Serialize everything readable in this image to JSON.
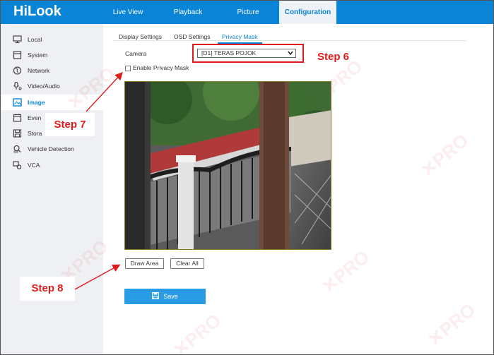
{
  "header": {
    "logo": "HiLook",
    "nav": [
      {
        "label": "Live View"
      },
      {
        "label": "Playback"
      },
      {
        "label": "Picture"
      },
      {
        "label": "Configuration",
        "active": true
      }
    ]
  },
  "sidebar": {
    "items": [
      {
        "label": "Local",
        "icon": "monitor-icon"
      },
      {
        "label": "System",
        "icon": "system-icon"
      },
      {
        "label": "Network",
        "icon": "globe-icon"
      },
      {
        "label": "Video/Audio",
        "icon": "video-audio-icon"
      },
      {
        "label": "Image",
        "icon": "image-icon",
        "active": true
      },
      {
        "label": "Even",
        "icon": "event-icon"
      },
      {
        "label": "Stora",
        "icon": "storage-icon"
      },
      {
        "label": "Vehicle Detection",
        "icon": "vehicle-icon"
      },
      {
        "label": "VCA",
        "icon": "vca-icon"
      }
    ]
  },
  "tabs": [
    {
      "label": "Display Settings"
    },
    {
      "label": "OSD Settings"
    },
    {
      "label": "Privacy Mask",
      "active": true
    }
  ],
  "form": {
    "camera_label": "Camera",
    "camera_value": "[D1] TERAS POJOK",
    "enable_label": "Enable Privacy Mask",
    "enable_checked": false
  },
  "buttons": {
    "draw_area": "Draw Area",
    "clear_all": "Clear All",
    "save": "Save"
  },
  "annotations": {
    "step6": "Step 6",
    "step7": "Step 7",
    "step8": "Step 8"
  },
  "colors": {
    "brand_blue": "#0a84d6",
    "annotation_red": "#e01b1b",
    "sidebar_bg": "#eef0f3"
  }
}
